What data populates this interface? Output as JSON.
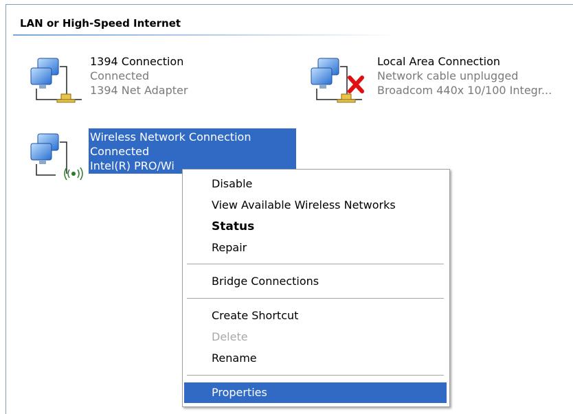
{
  "group": {
    "header": "LAN or High-Speed Internet"
  },
  "connections": [
    {
      "name": "1394 Connection",
      "status": "Connected",
      "device": "1394 Net Adapter",
      "icon": "network-connection-icon"
    },
    {
      "name": "Local Area Connection",
      "status": "Network cable unplugged",
      "device": "Broadcom 440x 10/100 Integr...",
      "icon": "network-disconnected-icon"
    },
    {
      "name": "Wireless Network Connection",
      "status": "Connected",
      "device": "Intel(R) PRO/Wi",
      "icon": "wireless-connection-icon",
      "selected": true
    }
  ],
  "context_menu": {
    "items": [
      {
        "label": "Disable"
      },
      {
        "label": "View Available Wireless Networks"
      },
      {
        "label": "Status",
        "bold": true
      },
      {
        "label": "Repair"
      },
      {
        "label": "Bridge Connections"
      },
      {
        "label": "Create Shortcut"
      },
      {
        "label": "Delete",
        "disabled": true
      },
      {
        "label": "Rename"
      },
      {
        "label": "Properties",
        "highlighted": true
      }
    ]
  },
  "colors": {
    "selection": "#316ac5",
    "header_line": "#79a6d6",
    "error": "#e01010"
  }
}
